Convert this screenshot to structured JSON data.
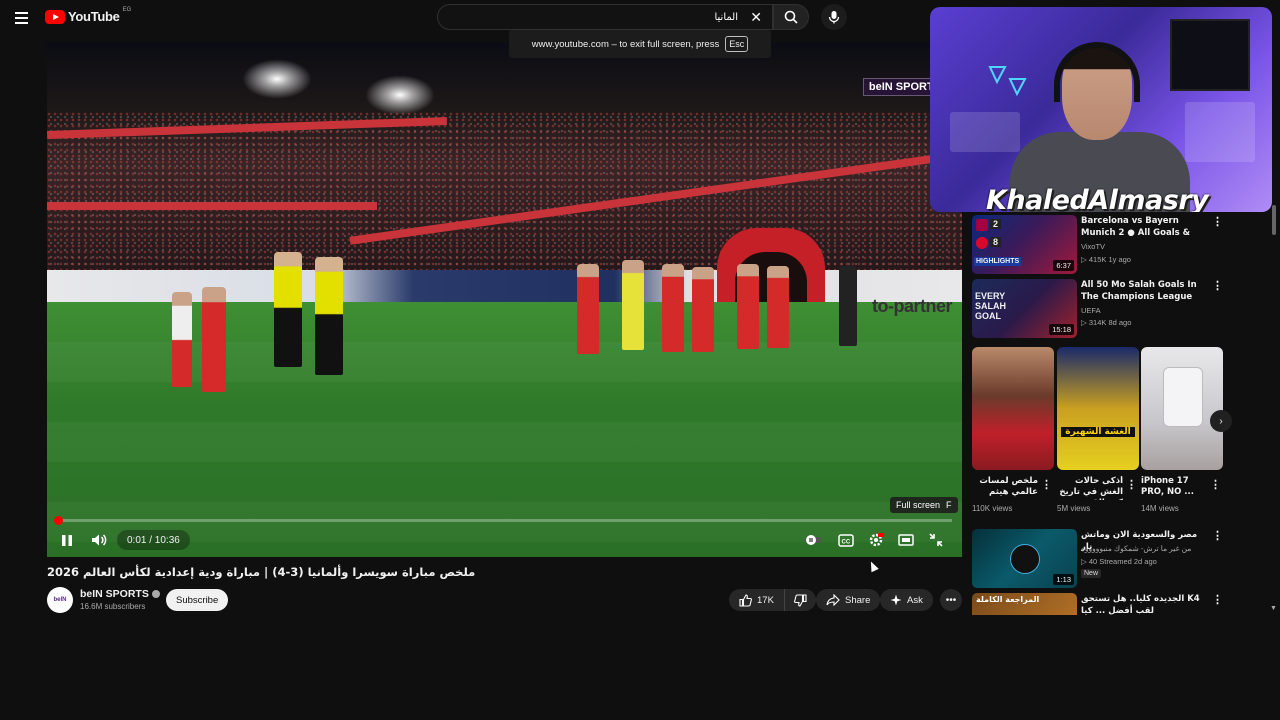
{
  "header": {
    "logo_text": "YouTube",
    "logo_region": "EG",
    "search_value": "المانيا",
    "clear_label": "✕",
    "fullscreen_toast": "www.youtube.com – to exit full screen, press",
    "toast_key": "Esc"
  },
  "player": {
    "channel_watermark": "beIN SPORTS",
    "time_current": "0:01",
    "time_total": "10:36",
    "time_display": "0:01 / 10:36",
    "progress_fraction": 0.0016,
    "fullscreen_tooltip": "Full screen",
    "fullscreen_key": "F",
    "adboard_text": "to-partner",
    "accent_color": "#ff0000"
  },
  "video": {
    "title": "ملخص مباراة سويسرا وألمانيا (3-4) | مباراة ودية إعدادية لكأس العالم 2026",
    "channel_name": "beIN SPORTS",
    "avatar_text": "beIN",
    "subscribers": "16.6M subscribers",
    "subscribe_label": "Subscribe",
    "likes": "17K",
    "share_label": "Share",
    "ask_label": "Ask",
    "more_label": "•••"
  },
  "webcam": {
    "streamer_name": "KhaledAlmasry"
  },
  "sidebar": {
    "videos": [
      {
        "title": "Barcelona vs Bayern Munich 2 ● All Goals & Highlights ...",
        "channel": "VixoTV",
        "meta": "▷ 415K  1y ago",
        "duration": "6:37",
        "thumb_text": "HIGHLIGHTS"
      },
      {
        "title": "All 50 Mo Salah Goals In The Champions League",
        "channel": "UEFA",
        "meta": "▷ 314K  8d ago",
        "duration": "15:18",
        "thumb_text": "EVERY SALAH GOAL"
      },
      {
        "title": "مصر والسعودية الان وماتش نار",
        "channel": "من غير ما ترش- شمكوك منبوووووه",
        "meta": "▷ 40  Streamed 2d ago",
        "duration": "1:13",
        "badge": "New"
      },
      {
        "title": "K4 الجديده كليا.. هل تستحق لقب أفضل ... كيا",
        "channel": "",
        "meta": "",
        "duration": "",
        "thumb_text": "المراجعة الكاملة"
      }
    ],
    "shorts": [
      {
        "title": "ملخص لمسات عالمي هيثم حسن",
        "views": "110K views"
      },
      {
        "title": "أذكى حالات الغش في تاريخ كرة القدم",
        "views": "5M views",
        "overlay": "الغشة الشهيرة"
      },
      {
        "title": "iPhone 17 PRO, NO ...",
        "views": "14M views"
      }
    ],
    "shorts_next": "›"
  }
}
